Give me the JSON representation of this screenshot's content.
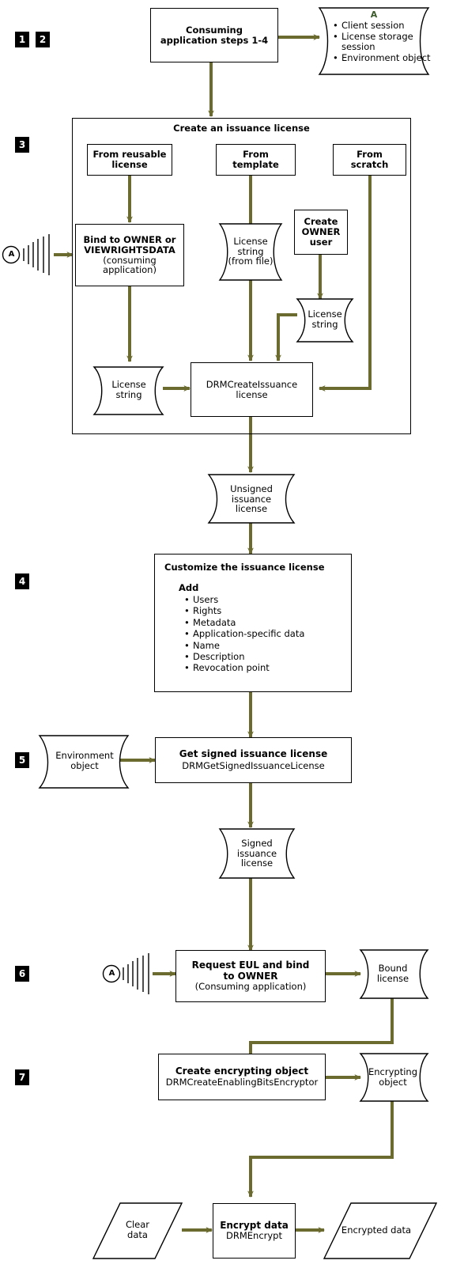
{
  "diagram": {
    "title": "Rights management issuance license creation flow",
    "accent_color": "#6b6b30",
    "callout_label_color": "#3a5a2a",
    "badge_bg": "#000000",
    "badge_fg": "#ffffff"
  },
  "badges": [
    {
      "id": "badge-1",
      "label": "1"
    },
    {
      "id": "badge-2",
      "label": "2"
    },
    {
      "id": "badge-3",
      "label": "3"
    },
    {
      "id": "badge-4",
      "label": "4"
    },
    {
      "id": "badge-5",
      "label": "5"
    },
    {
      "id": "badge-6",
      "label": "6"
    },
    {
      "id": "badge-7",
      "label": "7"
    }
  ],
  "connectors": {
    "a_letter": "A",
    "callout_a_label": "A"
  },
  "nodes": {
    "consuming_app": {
      "line1": "Consuming",
      "line2": "application steps 1-4"
    },
    "callout_a": {
      "label": "A",
      "items": [
        "Client session",
        "License storage",
        "session",
        "Environment object"
      ]
    },
    "group_title": "Create an issuance license",
    "from_reusable": {
      "line1": "From reusable",
      "line2": "license"
    },
    "from_template": {
      "line1": "From",
      "line2": "template"
    },
    "from_scratch": {
      "line1": "From",
      "line2": "scratch"
    },
    "bind_owner": {
      "line1": "Bind to OWNER or",
      "line2": "VIEWRIGHTSDATA",
      "line3": "(consuming",
      "line4": "application)"
    },
    "license_string_file": {
      "line1": "License",
      "line2": "string",
      "line3": "(from file)"
    },
    "create_owner_user": {
      "line1": "Create",
      "line2": "OWNER",
      "line3": "user"
    },
    "license_string_owner": {
      "line1": "License",
      "line2": "string"
    },
    "license_string_bind": {
      "line1": "License",
      "line2": "string"
    },
    "drm_create_issuance": {
      "line1": "DRMCreateIssuance",
      "line2": "license"
    },
    "unsigned_license": {
      "line1": "Unsigned",
      "line2": "issuance",
      "line3": "license"
    },
    "customize": {
      "title": "Customize the issuance license",
      "subtitle": "Add",
      "items": [
        "Users",
        "Rights",
        "Metadata",
        "Application-specific data",
        "Name",
        "Description",
        "Revocation point"
      ]
    },
    "environment_object": {
      "line1": "Environment",
      "line2": "object"
    },
    "get_signed": {
      "line1": "Get signed issuance license",
      "line2": "DRMGetSignedIssuanceLicense"
    },
    "signed_license": {
      "line1": "Signed",
      "line2": "issuance",
      "line3": "license"
    },
    "request_eul": {
      "line1": "Request EUL and bind",
      "line2": "to OWNER",
      "line3": "(Consuming application)"
    },
    "bound_license": {
      "line1": "Bound",
      "line2": "license"
    },
    "create_encrypting": {
      "line1": "Create encrypting object",
      "line2": "DRMCreateEnablingBitsEncryptor"
    },
    "encrypting_object": {
      "line1": "Encrypting",
      "line2": "object"
    },
    "clear_data": {
      "line1": "Clear",
      "line2": "data"
    },
    "encrypt_data": {
      "line1": "Encrypt data",
      "line2": "DRMEncrypt"
    },
    "encrypted_data": {
      "line1": "Encrypted data"
    }
  }
}
